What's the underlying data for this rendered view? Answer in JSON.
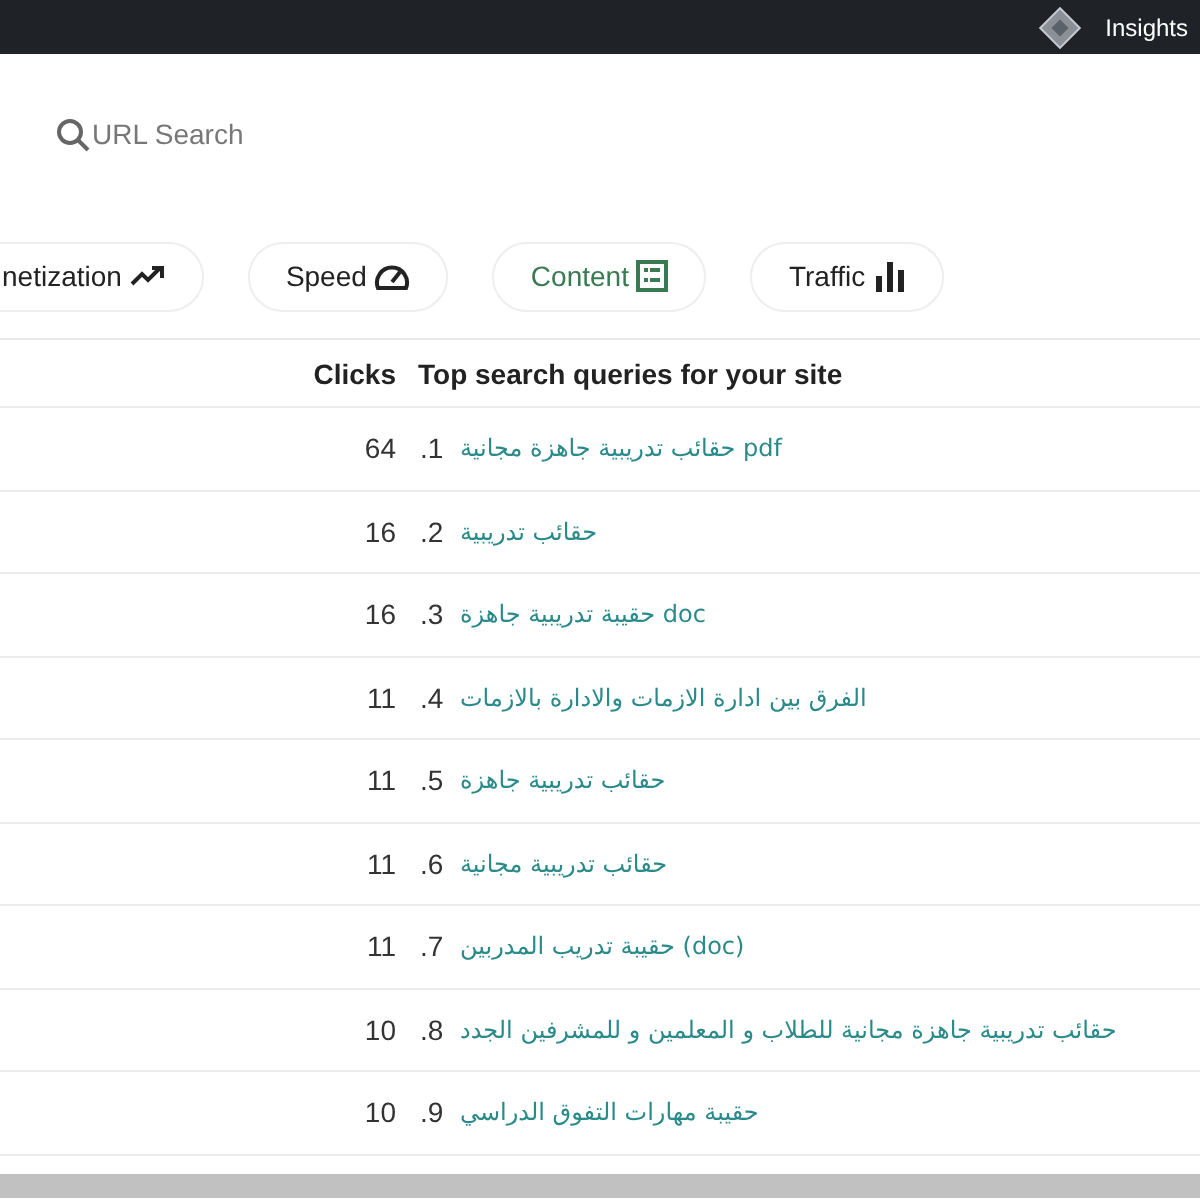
{
  "top_bar": {
    "title": "Insights"
  },
  "search": {
    "placeholder": "URL Search"
  },
  "tabs": [
    {
      "label": "Traffic",
      "kind": "bars",
      "selected": false
    },
    {
      "label": "Content",
      "kind": "list",
      "selected": true
    },
    {
      "label": "Speed",
      "kind": "gauge",
      "selected": false
    },
    {
      "label": "netization",
      "kind": "trend",
      "selected": false
    }
  ],
  "table": {
    "columns": [
      "Top search queries for your site",
      "Clicks"
    ],
    "rows": [
      {
        "clicks": "64",
        "rank": "1.",
        "query": "حقائب تدريبية جاهزة مجانية pdf"
      },
      {
        "clicks": "16",
        "rank": "2.",
        "query": "حقائب تدريبية"
      },
      {
        "clicks": "16",
        "rank": "3.",
        "query": "حقيبة تدريبية جاهزة doc"
      },
      {
        "clicks": "11",
        "rank": "4.",
        "query": "الفرق بين ادارة الازمات والادارة بالازمات"
      },
      {
        "clicks": "11",
        "rank": "5.",
        "query": "حقائب تدريبية جاهزة"
      },
      {
        "clicks": "11",
        "rank": "6.",
        "query": "حقائب تدريبية مجانية"
      },
      {
        "clicks": "11",
        "rank": "7.",
        "query": "حقيبة تدريب المدربين (doc)"
      },
      {
        "clicks": "10",
        "rank": "8.",
        "query": "حقائب تدريبية جاهزة مجانية للطلاب و المعلمين و للمشرفين الجدد"
      },
      {
        "clicks": "10",
        "rank": "9.",
        "query": "حقيبة مهارات التفوق الدراسي"
      }
    ]
  }
}
